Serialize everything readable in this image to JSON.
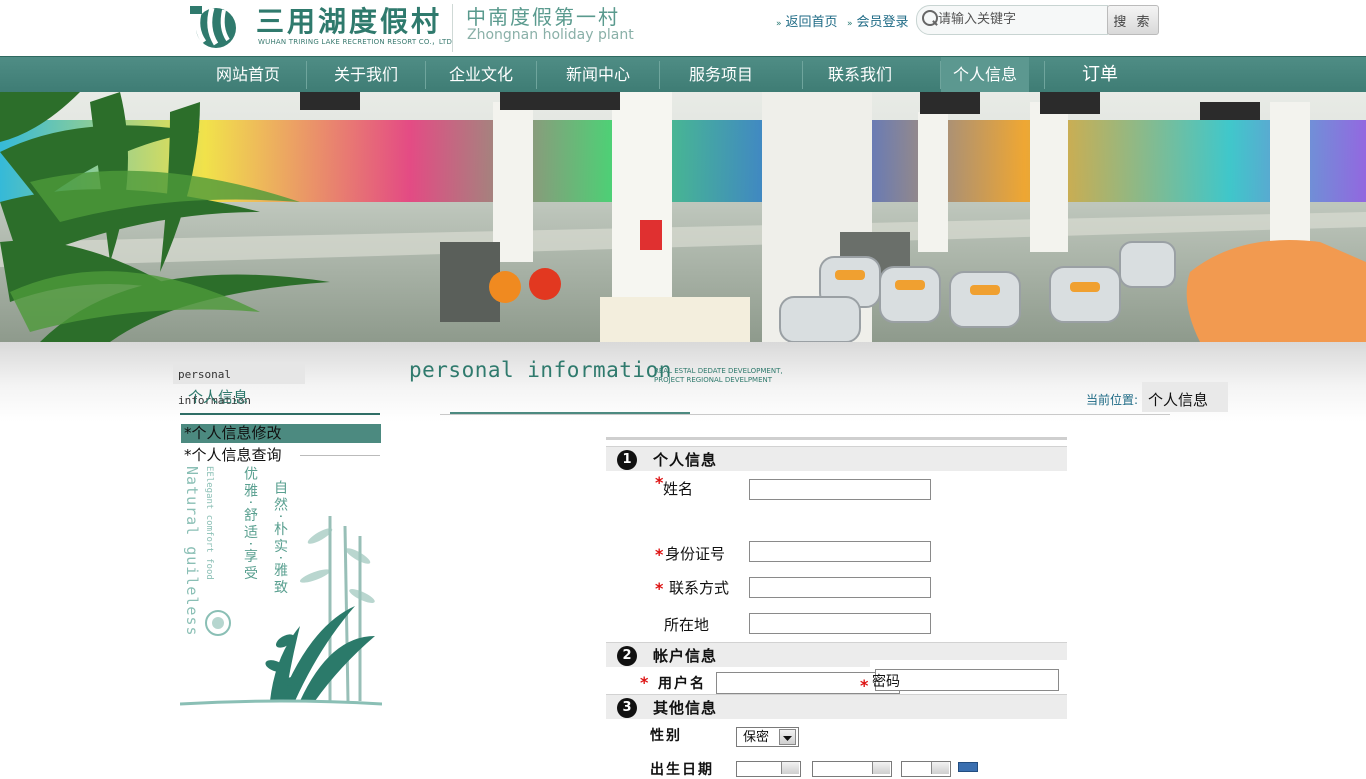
{
  "header": {
    "logo_cn": "三用湖度假村",
    "logo_en": "WUHAN TRIRING LAKE RECRETION RESORT CO.，LTD",
    "slogan_cn": "中南度假第一村",
    "slogan_en": "Zhongnan holiday plant",
    "links": {
      "home": "返回首页",
      "login": "会员登录"
    },
    "search": {
      "placeholder": "请输入关键字",
      "button": "搜 索"
    }
  },
  "nav": {
    "items": [
      "网站首页",
      "关于我们",
      "企业文化",
      "新闻中心",
      "服务项目",
      "联系我们",
      "个人信息",
      "订单"
    ],
    "active": "个人信息"
  },
  "sidebar": {
    "tag_en": "personal information",
    "tag_cn": "个人信息",
    "menu": [
      "*个人信息修改",
      "*个人信息查询"
    ],
    "deco_en_1": "EElegant comfort food",
    "deco_en_2": "Natural guileless",
    "deco_cn_1": "优雅·舒适·享受",
    "deco_cn_2": "自然·朴实·雅致"
  },
  "content": {
    "title_en": "personal information",
    "sub_en_1": "REAL ESTAL DEDATE DEVELOPMENT,",
    "sub_en_2": "PROJECT REGIONAL DEVELPMENT",
    "breadcrumb_label": "当前位置:",
    "breadcrumb_value": "个人信息"
  },
  "form": {
    "sections": [
      {
        "num": "1",
        "title": "个人信息"
      },
      {
        "num": "2",
        "title": "帐户信息"
      },
      {
        "num": "3",
        "title": "其他信息"
      }
    ],
    "fields": {
      "name": "姓名",
      "id_number": "身份证号",
      "contact": "联系方式",
      "location": "所在地",
      "username": "用户名",
      "password": "密码",
      "gender": "性别",
      "birthdate": "出生日期"
    },
    "required_mark": "*",
    "gender_value": "保密"
  }
}
